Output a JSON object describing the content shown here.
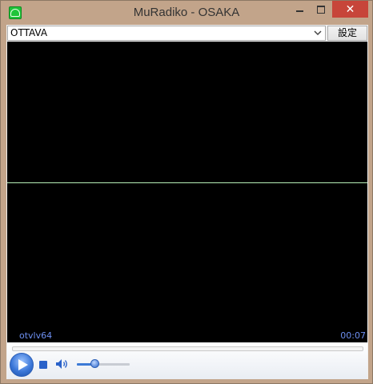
{
  "window": {
    "title": "MuRadiko - OSAKA",
    "close_glyph": "✕"
  },
  "toolbar": {
    "station": "OTTAVA",
    "settings_label": "設定"
  },
  "visualizer": {
    "stream_id": "otvlv64",
    "elapsed": "00:07"
  },
  "controls": {
    "volume_level": 0.3
  },
  "icons": {
    "app": "radio-app-icon",
    "play": "play-icon",
    "stop": "stop-icon",
    "volume": "speaker-icon",
    "dropdown": "chevron-down-icon"
  },
  "colors": {
    "frame": "#c2a48a",
    "close": "#c7453a",
    "visualizer_bg": "#000000",
    "wave": "#b8f0b8",
    "overlay_text": "#6d8ff0",
    "accent": "#2a62c9"
  }
}
